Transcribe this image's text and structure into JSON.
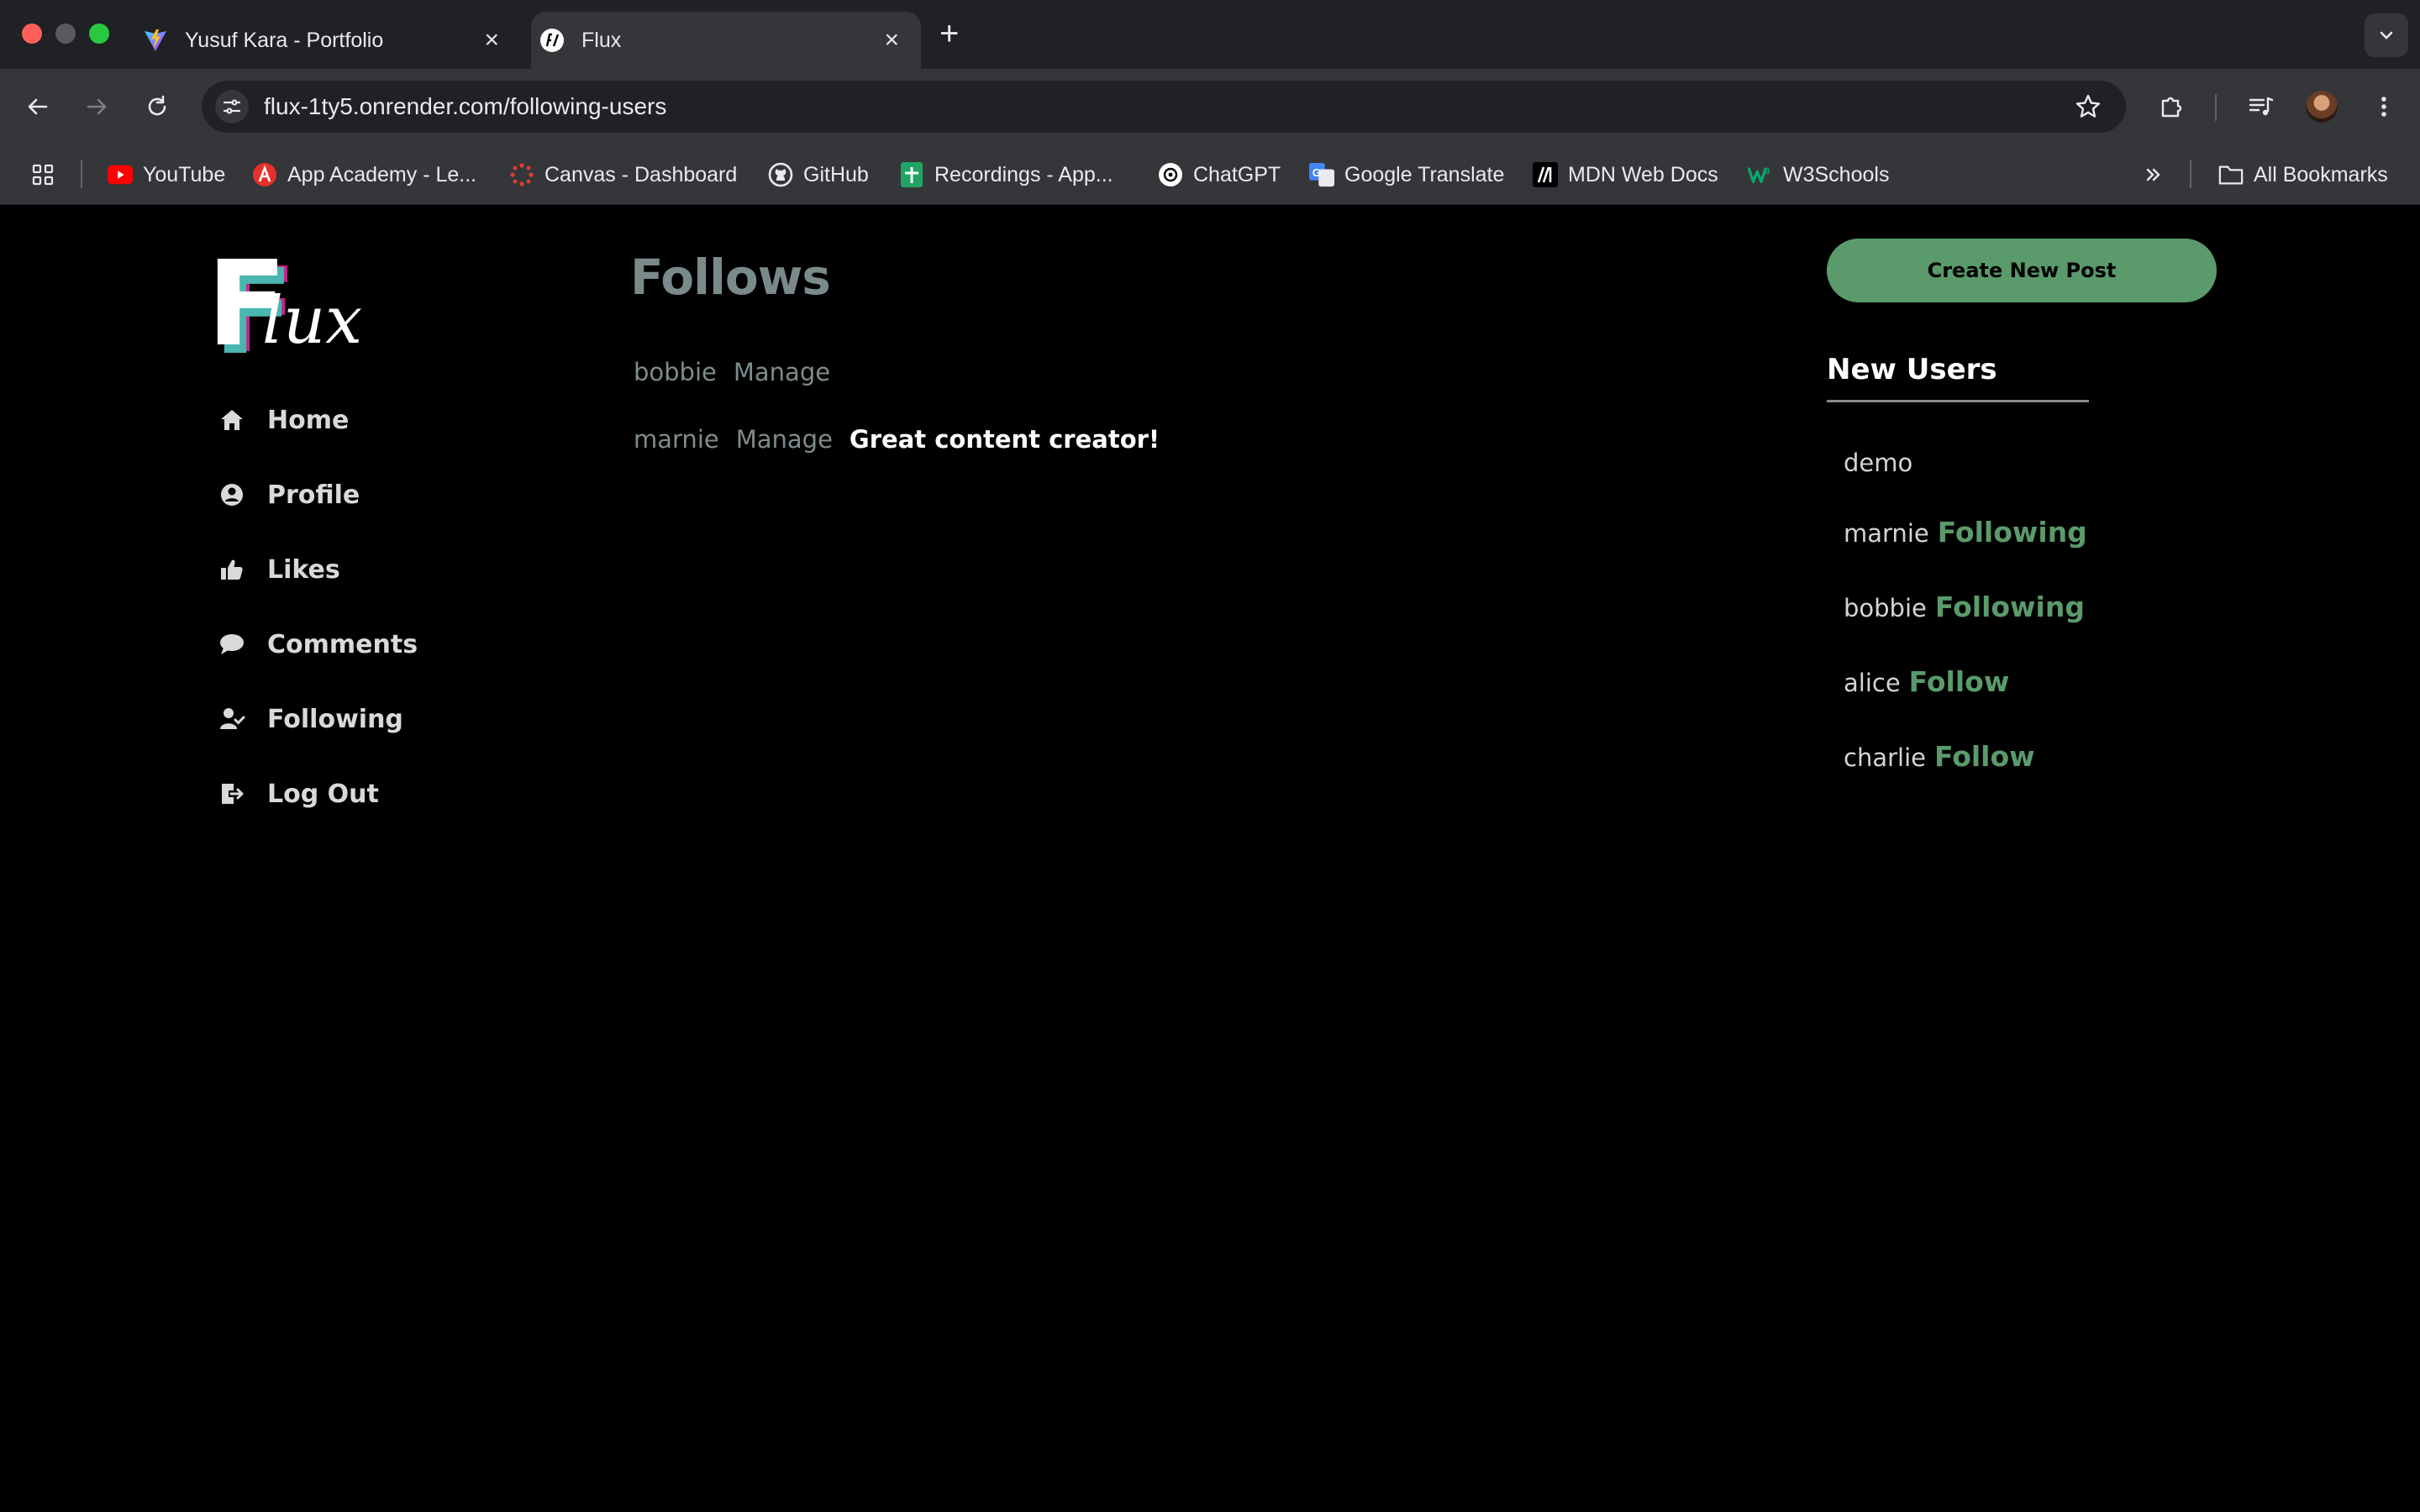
{
  "browser": {
    "tabs": [
      {
        "title": "Yusuf Kara - Portfolio",
        "active": false,
        "icon": "vite-icon"
      },
      {
        "title": "Flux",
        "active": true,
        "icon": "flux-icon"
      }
    ],
    "url": "flux-1ty5.onrender.com/following-users",
    "bookmarks": [
      {
        "label": "YouTube",
        "icon": "youtube-icon"
      },
      {
        "label": "App Academy - Le...",
        "icon": "app-academy-icon"
      },
      {
        "label": "Canvas - Dashboard",
        "icon": "canvas-icon"
      },
      {
        "label": "GitHub",
        "icon": "github-icon"
      },
      {
        "label": "Recordings - App...",
        "icon": "sheets-icon"
      },
      {
        "label": "ChatGPT",
        "icon": "chatgpt-icon"
      },
      {
        "label": "Google Translate",
        "icon": "translate-icon"
      },
      {
        "label": "MDN Web Docs",
        "icon": "mdn-icon"
      },
      {
        "label": "W3Schools",
        "icon": "w3schools-icon"
      }
    ],
    "all_bookmarks": "All Bookmarks",
    "colors": {
      "tabstrip": "#202124",
      "toolbar": "#35363a"
    }
  },
  "app": {
    "logo": {
      "letter": "F",
      "rest": "lux"
    },
    "nav": [
      {
        "label": "Home",
        "icon": "home-icon"
      },
      {
        "label": "Profile",
        "icon": "profile-icon"
      },
      {
        "label": "Likes",
        "icon": "thumbs-up-icon"
      },
      {
        "label": "Comments",
        "icon": "comment-icon"
      },
      {
        "label": "Following",
        "icon": "user-check-icon"
      },
      {
        "label": "Log Out",
        "icon": "logout-icon"
      }
    ],
    "main": {
      "title": "Follows",
      "follows": [
        {
          "name": "bobbie",
          "action": "Manage",
          "note": ""
        },
        {
          "name": "marnie",
          "action": "Manage",
          "note": "Great content creator!"
        }
      ]
    },
    "right": {
      "create_button": "Create New Post",
      "new_users_title": "New Users",
      "users": [
        {
          "name": "demo",
          "action": ""
        },
        {
          "name": "marnie",
          "action": "Following"
        },
        {
          "name": "bobbie",
          "action": "Following"
        },
        {
          "name": "alice",
          "action": "Follow"
        },
        {
          "name": "charlie",
          "action": "Follow"
        }
      ]
    },
    "colors": {
      "accent": "#5a9a6b",
      "muted": "#7d8c8c",
      "background": "#000000"
    }
  }
}
